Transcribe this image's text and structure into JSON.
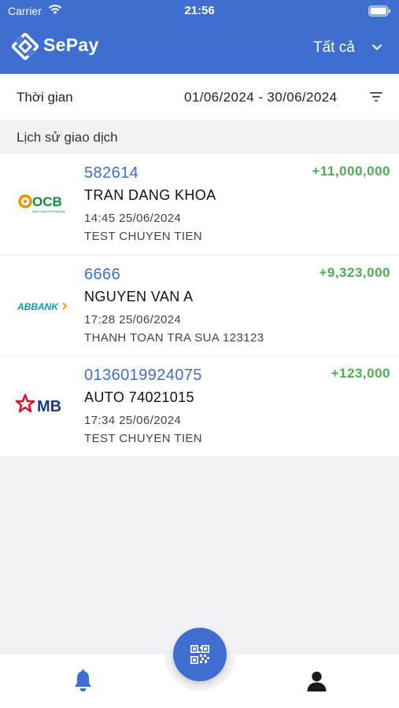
{
  "status_bar": {
    "carrier": "Carrier",
    "time": "21:56"
  },
  "header": {
    "app_name": "SePay",
    "filter_selected": "Tất cả",
    "brand_color": "#3e6fd0"
  },
  "time_filter": {
    "label": "Thời gian",
    "range": "01/06/2024 - 30/06/2024"
  },
  "history": {
    "title": "Lịch sử giao dịch",
    "transactions": [
      {
        "bank": "OCB",
        "bank_logo_tagline": "Ngân hàng Phương Đông",
        "account": "582614",
        "name": "TRAN DANG KHOA",
        "datetime": "14:45 25/06/2024",
        "content": "TEST CHUYEN TIEN",
        "amount": "+11,000,000"
      },
      {
        "bank": "ABBANK",
        "account": "6666",
        "name": "NGUYEN VAN A",
        "datetime": "17:28 25/06/2024",
        "content": "THANH TOAN TRA SUA 123123",
        "amount": "+9,323,000"
      },
      {
        "bank": "MB",
        "account": "0136019924075",
        "name": "AUTO 74021015",
        "datetime": "17:34 25/06/2024",
        "content": "TEST CHUYEN TIEN",
        "amount": "+123,000"
      }
    ]
  },
  "tab_bar": {
    "icons": [
      "bell-icon",
      "qr-code-icon",
      "user-icon"
    ]
  },
  "colors": {
    "primary": "#3e6fd0",
    "amount_positive": "#4cae54",
    "background": "#f2f2f4"
  }
}
